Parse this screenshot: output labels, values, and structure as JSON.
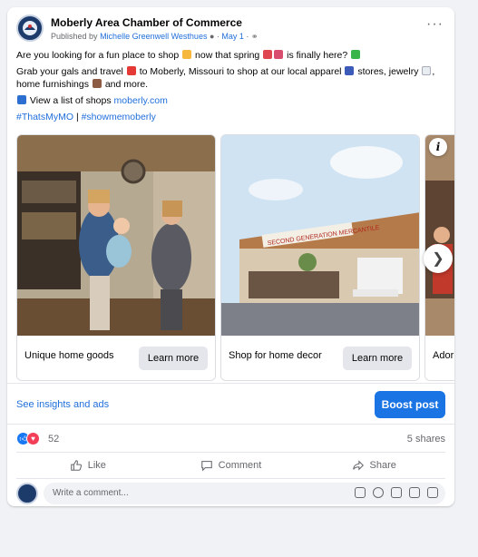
{
  "post": {
    "page_name": "Moberly Area Chamber of Commerce",
    "published_by_prefix": "Published by",
    "publisher": "Michelle Greenwell Westhues",
    "date": "May 1",
    "text_line1": "Are you looking for a fun place to shop",
    "text_line1b": "now that spring",
    "text_line1c": "is finally here?",
    "text_line2a": "Grab your gals and travel",
    "text_line2b": "to Moberly, Missouri to shop at our local apparel",
    "text_line2c": "stores, jewelry",
    "text_line2d": ",",
    "text_line3a": "home furnishings",
    "text_line3b": "and more.",
    "shops_text": "View a list of shops",
    "shops_link": "moberly.com",
    "hashtag1": "#ThatsMyMO",
    "hashtag_sep": "|",
    "hashtag2": "#showmemoberly"
  },
  "carousel": {
    "cards": [
      {
        "title": "Unique home goods",
        "button": "Learn more"
      },
      {
        "title": "Shop for home decor",
        "button": "Learn more"
      },
      {
        "title": "Ador"
      }
    ],
    "store_sign": "SECOND GENERATION MERCANTILE",
    "info_label": "i"
  },
  "insights": {
    "link": "See insights and ads",
    "boost": "Boost post"
  },
  "stats": {
    "reactions": "52",
    "shares": "5 shares"
  },
  "actions": {
    "like": "Like",
    "comment": "Comment",
    "share": "Share"
  },
  "comment": {
    "placeholder": "Write a comment..."
  },
  "colors": {
    "accent": "#1b74e4",
    "link": "#216fdb",
    "like_blue": "#1877f2",
    "love_red": "#f33e58"
  }
}
